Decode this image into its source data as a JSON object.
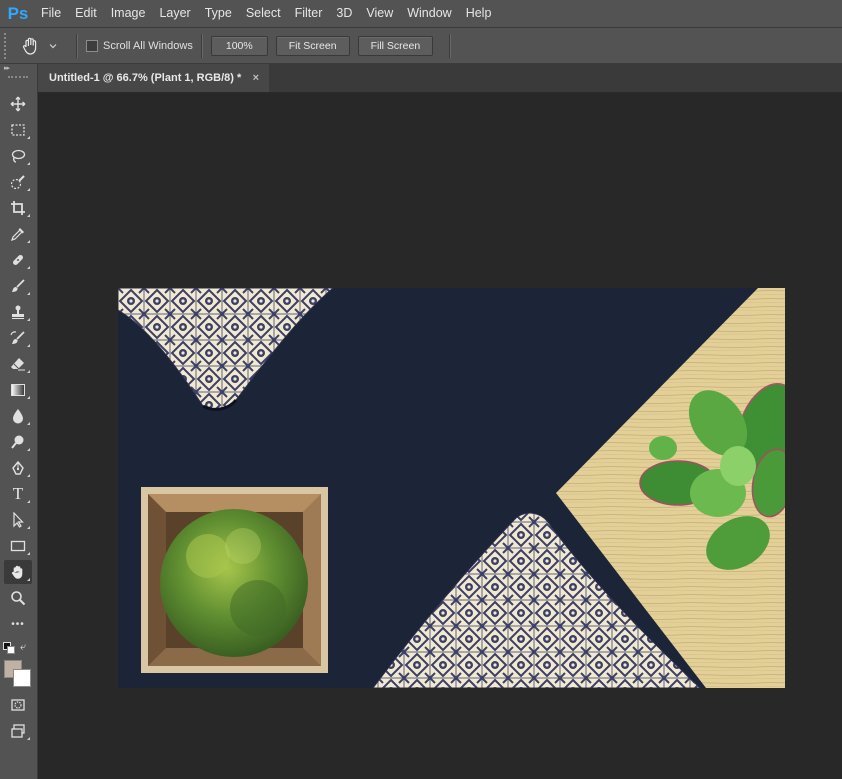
{
  "app": {
    "logo": "Ps"
  },
  "menu": [
    "File",
    "Edit",
    "Image",
    "Layer",
    "Type",
    "Select",
    "Filter",
    "3D",
    "View",
    "Window",
    "Help"
  ],
  "options": {
    "tool_icon": "hand-icon",
    "scroll_all_windows_label": "Scroll All Windows",
    "scroll_all_windows_checked": false,
    "zoom_100_label": "100%",
    "fit_screen_label": "Fit Screen",
    "fill_screen_label": "Fill Screen"
  },
  "document": {
    "tab_title": "Untitled-1 @ 66.7% (Plant 1, RGB/8) *",
    "close_glyph": "×"
  },
  "tools": [
    {
      "name": "move-tool-icon"
    },
    {
      "name": "rectangular-marquee-icon"
    },
    {
      "name": "lasso-icon"
    },
    {
      "name": "quick-selection-icon"
    },
    {
      "name": "crop-icon"
    },
    {
      "name": "eyedropper-icon"
    },
    {
      "name": "healing-brush-icon"
    },
    {
      "name": "brush-icon"
    },
    {
      "name": "clone-stamp-icon"
    },
    {
      "name": "history-brush-icon"
    },
    {
      "name": "eraser-icon"
    },
    {
      "name": "gradient-icon"
    },
    {
      "name": "blur-icon"
    },
    {
      "name": "dodge-icon"
    },
    {
      "name": "pen-icon"
    },
    {
      "name": "type-icon",
      "glyph": "T"
    },
    {
      "name": "path-selection-icon"
    },
    {
      "name": "rectangle-shape-icon"
    },
    {
      "name": "hand-icon",
      "active": true
    },
    {
      "name": "zoom-icon"
    },
    {
      "name": "more-tools-icon",
      "glyph": "•••"
    }
  ],
  "colors": {
    "menubar": "#535353",
    "canvas_bg": "#282828",
    "foreground_swatch": "#c1b1a3",
    "background_swatch": "#ffffff",
    "ps_brand": "#31a8ff",
    "image_navy": "#1c2438",
    "wood": "#e3cf98"
  }
}
